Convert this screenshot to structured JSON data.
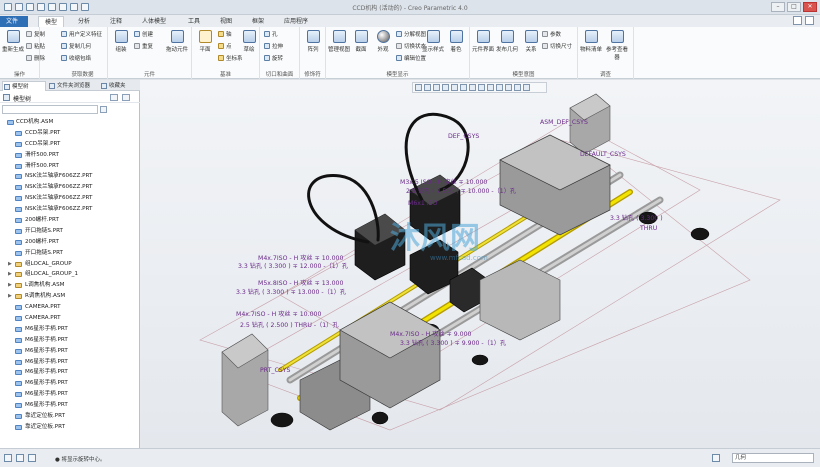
{
  "window": {
    "title": "CCD机构 (活动的) - Creo Parametric 4.0"
  },
  "tabs": [
    "文件",
    "模型",
    "分析",
    "注释",
    "人体模型",
    "工具",
    "视图",
    "框架",
    "应用程序"
  ],
  "ribbon": {
    "operations": {
      "label": "操作",
      "regen": "重新生成",
      "copy": "复制",
      "paste": "粘贴",
      "delete": "删除"
    },
    "get_data": {
      "label": "获取数据",
      "udf": "用户定义特征",
      "copy_geom": "复制几何",
      "shrinkwrap": "收缩包络"
    },
    "component": {
      "label": "元件",
      "assemble": "组装",
      "create": "创建",
      "repeat": "重复",
      "drag": "拖动元件"
    },
    "datum": {
      "label": "基准",
      "plane": "平面",
      "axis": "轴",
      "point": "点",
      "csys": "坐标系",
      "sketch": "草绘"
    },
    "cut_surface": {
      "label": "切口和曲面",
      "hole": "孔",
      "extrude": "拉伸",
      "revolve": "旋转"
    },
    "modifiers": {
      "label": "修饰符",
      "pattern": "阵列"
    },
    "model_display": {
      "label": "模型显示",
      "manage_views": "管理视图",
      "section": "截面",
      "appearance": "外观",
      "explode": "分解视图",
      "edit_position": "编辑位置",
      "switch_state": "切换状态",
      "display_style": "显示样式",
      "shaded": "着色"
    },
    "model_intent": {
      "label": "模型意图",
      "component_interface": "元件界面",
      "publish_geom": "发布几何",
      "relations": "关系",
      "params": "参数",
      "switch_dims": "切换尺寸"
    },
    "investigate": {
      "label": "调查",
      "bom": "物料清单",
      "ref_viewer": "参考查看器"
    }
  },
  "left_panel": {
    "tabs": [
      "模型树",
      "文件夹浏览器",
      "收藏夹"
    ],
    "header": "模型树",
    "tree": [
      {
        "label": "CCD机构.ASM",
        "type": "root",
        "expand": ""
      },
      {
        "label": "CCD吊架.PRT",
        "type": "part",
        "expand": ""
      },
      {
        "label": "CCD吊架.PRT",
        "type": "part",
        "expand": ""
      },
      {
        "label": "滑杆500.PRT",
        "type": "part",
        "expand": ""
      },
      {
        "label": "滑杆500.PRT",
        "type": "part",
        "expand": ""
      },
      {
        "label": "NSK法兰轴承F606ZZ.PRT",
        "type": "part",
        "expand": ""
      },
      {
        "label": "NSK法兰轴承F606ZZ.PRT",
        "type": "part",
        "expand": ""
      },
      {
        "label": "NSK法兰轴承F606ZZ.PRT",
        "type": "part",
        "expand": ""
      },
      {
        "label": "NSK法兰轴承F606ZZ.PRT",
        "type": "part",
        "expand": ""
      },
      {
        "label": "200螺杆.PRT",
        "type": "part",
        "expand": ""
      },
      {
        "label": "开口拖链S.PRT",
        "type": "part",
        "expand": ""
      },
      {
        "label": "200螺杆.PRT",
        "type": "part",
        "expand": ""
      },
      {
        "label": "开口拖链S.PRT",
        "type": "part",
        "expand": ""
      },
      {
        "label": "组LOCAL_GROUP",
        "type": "asm",
        "expand": "▶"
      },
      {
        "label": "组LOCAL_GROUP_1",
        "type": "asm",
        "expand": "▶"
      },
      {
        "label": "L调焦机构.ASM",
        "type": "asm",
        "expand": "▶"
      },
      {
        "label": "R调焦机构.ASM",
        "type": "asm",
        "expand": "▶"
      },
      {
        "label": "CAMERA.PRT",
        "type": "part",
        "expand": ""
      },
      {
        "label": "CAMERA.PRT",
        "type": "part",
        "expand": ""
      },
      {
        "label": "M6星形手柄.PRT",
        "type": "part",
        "expand": ""
      },
      {
        "label": "M6星形手柄.PRT",
        "type": "part",
        "expand": ""
      },
      {
        "label": "M6星形手柄.PRT",
        "type": "part",
        "expand": ""
      },
      {
        "label": "M6星形手柄.PRT",
        "type": "part",
        "expand": ""
      },
      {
        "label": "M6星形手柄.PRT",
        "type": "part",
        "expand": ""
      },
      {
        "label": "M6星形手柄.PRT",
        "type": "part",
        "expand": ""
      },
      {
        "label": "M6星形手柄.PRT",
        "type": "part",
        "expand": ""
      },
      {
        "label": "M6星形手柄.PRT",
        "type": "part",
        "expand": ""
      },
      {
        "label": "靠近定位板.PRT",
        "type": "part",
        "expand": ""
      },
      {
        "label": "靠近定位板.PRT",
        "type": "part",
        "expand": ""
      }
    ]
  },
  "viewport": {
    "annotations": [
      "M4x.7ISO - H 攻丝 ∓ 10.000",
      "3.3 钻孔 ( 3.300 ) ∓ 12.000 -（1）孔",
      "M5x.8ISO - H 攻丝 ∓ 13.000",
      "3.3 钻孔 ( 3.300 ) ∓ 13.000 -（1）孔",
      "M4x.7ISO - H 攻丝 ∓ 9.000",
      "3.3 钻孔 ( 3.300 ) ∓ 9.900 -（1）孔",
      "M3x.5 ISO - H 攻丝 ∓ 10.000",
      "2.5 钻孔 ( 2.500 ) ∓ 10.000 -（1）孔",
      "M4x.7ISO - H 攻丝 ∓ 10.000",
      "2.5 钻孔 ( 2.500 ) THRU -（1）孔",
      "M6x1 ISO",
      "3.3 钻孔 ( 3.300 )",
      "THRU",
      "DEF_CSYS",
      "ASM_DEF_CSYS",
      "DEFAULT_CSYS",
      "PRT_CSYS"
    ],
    "watermark": "沐风网",
    "watermark_url": "www.mfcad.com"
  },
  "status": {
    "message": "● 将显示旋转中心。",
    "filter": "几何"
  }
}
